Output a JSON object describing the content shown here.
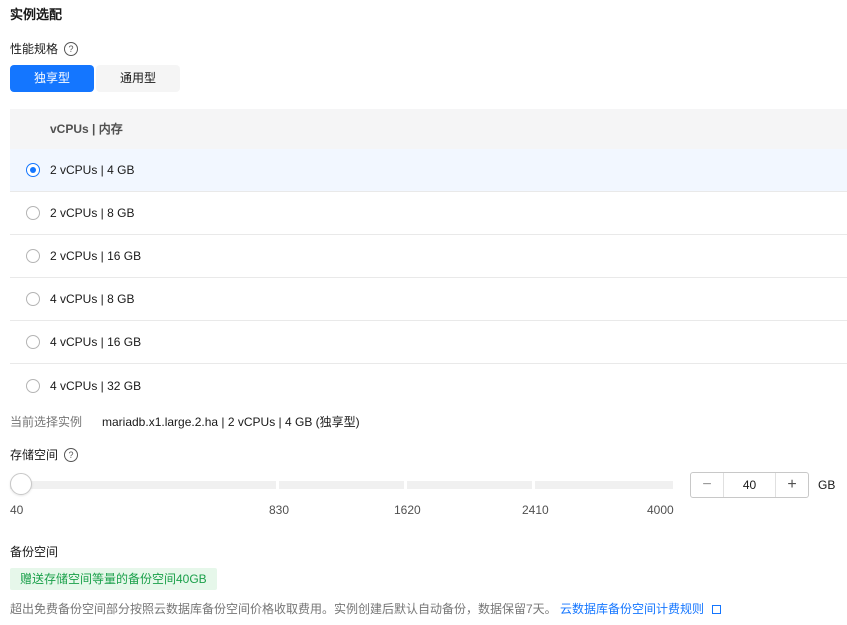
{
  "section": {
    "title": "实例选配"
  },
  "performance": {
    "label": "性能规格",
    "help_icon": "?"
  },
  "tabs": [
    {
      "label": "独享型",
      "active": true
    },
    {
      "label": "通用型",
      "active": false
    }
  ],
  "table": {
    "header": "vCPUs | 内存",
    "rows": [
      {
        "label": "2 vCPUs | 4 GB",
        "selected": true
      },
      {
        "label": "2 vCPUs | 8 GB",
        "selected": false
      },
      {
        "label": "2 vCPUs | 16 GB",
        "selected": false
      },
      {
        "label": "4 vCPUs | 8 GB",
        "selected": false
      },
      {
        "label": "4 vCPUs | 16 GB",
        "selected": false
      },
      {
        "label": "4 vCPUs | 32 GB",
        "selected": false
      }
    ]
  },
  "current": {
    "label": "当前选择实例",
    "value": "mariadb.x1.large.2.ha | 2 vCPUs | 4 GB (独享型)"
  },
  "storage": {
    "label": "存储空间",
    "help_icon": "?",
    "ticks": [
      "40",
      "830",
      "1620",
      "2410",
      "4000"
    ],
    "value": "40",
    "unit": "GB",
    "minus": "−",
    "plus": "+"
  },
  "backup": {
    "label": "备份空间",
    "badge": "赠送存储空间等量的备份空间40GB",
    "note": "超出免费备份空间部分按照云数据库备份空间价格收取费用。实例创建后默认自动备份，数据保留7天。",
    "link": "云数据库备份空间计费规则"
  },
  "colors": {
    "accent": "#1476ff",
    "badge_bg": "#e6f7ea",
    "badge_text": "#1aa04a"
  }
}
